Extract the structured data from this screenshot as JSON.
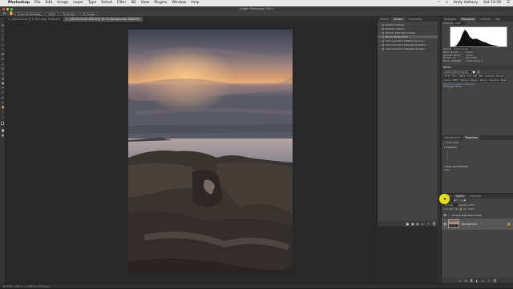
{
  "menubar": {
    "apple": "",
    "items": [
      "Photoshop",
      "File",
      "Edit",
      "Image",
      "Layer",
      "Type",
      "Select",
      "Filter",
      "3D",
      "View",
      "Plugins",
      "Window",
      "Help"
    ],
    "right": {
      "user": "Andy Astbury",
      "time": "Sat 13:39"
    }
  },
  "app_title": "Adobe Photoshop 2023",
  "options": {
    "btn1": "Scroll All Windows",
    "btn2": "100%",
    "btn3": "Fit Screen",
    "btn4": "Fill Screen"
  },
  "tabs": [
    {
      "label": "_DSC4210.tif @ 17.6% (Lay.. RGB/16*)",
      "active": false
    },
    {
      "label": "_DSC4219-Edit-Edit.tif @ 16.7% (Background, RGB/16*)",
      "active": true
    }
  ],
  "status": "16.67%     1.067 in x 1.667 in (300 ppi)",
  "actions_panel": {
    "tabs": [
      "History",
      "Actions",
      "Comments"
    ],
    "rows": [
      {
        "label": "Default Actions",
        "selected": false
      },
      {
        "label": "Sample Actions",
        "selected": false
      },
      {
        "label": "Double High Pass Clarity",
        "selected": false
      },
      {
        "label": "Blend Rotate Mask",
        "selected": true
      },
      {
        "label": "Deconvolution Sharpening Low...",
        "selected": false
      },
      {
        "label": "Deconvolution Sharpening Mediu...",
        "selected": false
      },
      {
        "label": "Deconvolution Sharpening High...",
        "selected": false
      }
    ]
  },
  "histogram_panel": {
    "tabs": [
      "Navigator",
      "Histogram",
      "Libraries",
      "Info"
    ],
    "channel_label": "Channel:",
    "channel_value": "RGB",
    "source_label": "Source:",
    "source_value": "Entire Image",
    "stats": [
      [
        "Mean:",
        "91.48"
      ],
      [
        "Std Dev:",
        "44.49"
      ],
      [
        "Median:",
        "91"
      ],
      [
        "Pixels:",
        "2456848"
      ],
      [
        "Level:",
        ""
      ],
      [
        "Count:",
        ""
      ],
      [
        "Percentile:",
        ""
      ],
      [
        "Cache Level:",
        "4"
      ]
    ]
  },
  "clarity_panel": {
    "title": "Basics",
    "tag_labels": [
      "TF-M",
      "TF-L",
      "DEST",
      "T-N",
      "LIM",
      "BIG",
      "Remove",
      "Shrink",
      "Grow",
      "DEST",
      "Nouvel",
      "Merge",
      "Wrong",
      "Rename",
      "Mask"
    ],
    "link_text": "Raya Pro Exposure Blending",
    "footer": "ProDesign Mode"
  },
  "properties_panel": {
    "tabs": [
      "Adjustments",
      "Properties"
    ],
    "pixel_layer": "Pixel Layer",
    "transform": "Transform",
    "align": "Align and Distribute",
    "align_sub": "Align"
  },
  "layers_panel": {
    "tabs": [
      "Layers",
      "Paths",
      "Channels"
    ],
    "kind": "Kind",
    "mode": "Normal",
    "opacity_label": "Opacity:",
    "opacity": "100%",
    "lock_label": "Lock:",
    "fill_label": "Fill:",
    "fill": "100%",
    "group_layer": "Double High Pass Clarity",
    "bg_layer": "Background"
  },
  "colors": {
    "accent": "#2d6fc5",
    "highlight": "#e4e000"
  }
}
